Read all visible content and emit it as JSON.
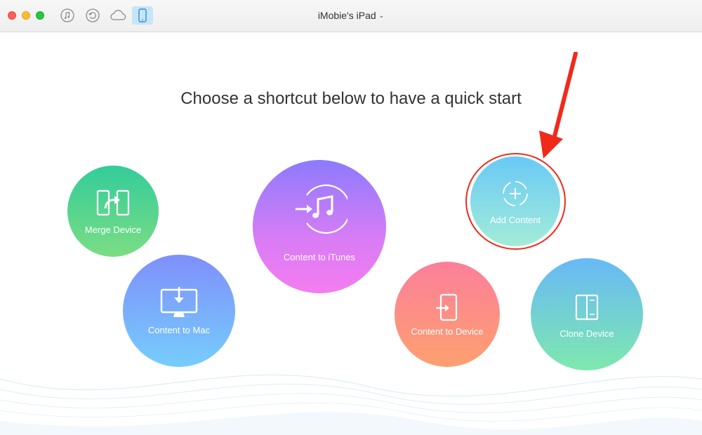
{
  "titlebar": {
    "window_controls": [
      "close",
      "minimize",
      "zoom"
    ],
    "toolbar_icons": [
      "itunes-icon",
      "restore-icon",
      "cloud-icon",
      "device-icon"
    ],
    "active_icon": "device-icon",
    "device_name": "iMobie's iPad",
    "device_caret": "⌄"
  },
  "main": {
    "headline": "Choose a shortcut below to have a quick start",
    "shortcuts": [
      {
        "id": "merge-device",
        "label": "Merge Device",
        "icon": "merge-icon",
        "color_top": "#33cc9a",
        "color_bottom": "#7bdd84"
      },
      {
        "id": "content-to-mac",
        "label": "Content to Mac",
        "icon": "monitor-download-icon",
        "color_top": "#7f8ffb",
        "color_bottom": "#76cdfc"
      },
      {
        "id": "content-to-itunes",
        "label": "Content to iTunes",
        "icon": "music-arrow-icon",
        "color_top": "#8c7bfd",
        "color_bottom": "#f47cf0"
      },
      {
        "id": "add-content",
        "label": "Add Content",
        "icon": "add-circle-icon",
        "color_top": "#69c9f6",
        "color_bottom": "#a3ecd8",
        "highlighted": true
      },
      {
        "id": "content-to-device",
        "label": "Content to Device",
        "icon": "phone-import-icon",
        "color_top": "#fc7f9b",
        "color_bottom": "#fda06f"
      },
      {
        "id": "clone-device",
        "label": "Clone Device",
        "icon": "clone-icon",
        "color_top": "#67b9f6",
        "color_bottom": "#7fe8ae"
      }
    ]
  },
  "annotation": {
    "arrow_color": "#f02a1a",
    "ring_color": "#f02a1a"
  }
}
